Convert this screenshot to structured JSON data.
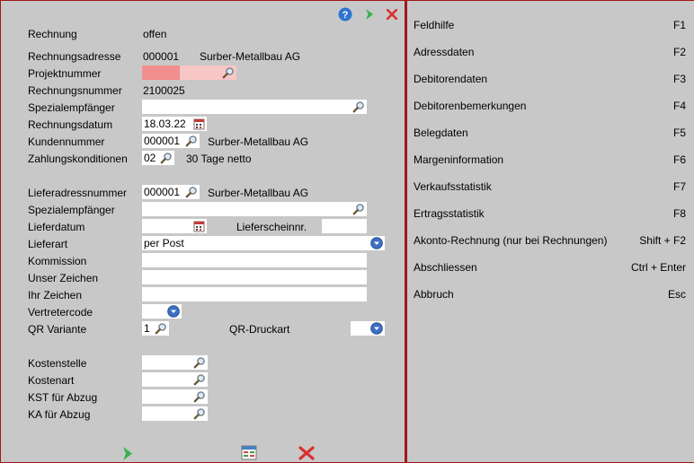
{
  "form": {
    "rechnung_label": "Rechnung",
    "rechnung_status": "offen",
    "rechnungsadresse_label": "Rechnungsadresse",
    "rechnungsadresse_nr": "000001",
    "rechnungsadresse_name": "Surber-Metallbau AG",
    "projektnummer_label": "Projektnummer",
    "projektnummer_value": "",
    "rechnungsnummer_label": "Rechnungsnummer",
    "rechnungsnummer_value": "2100025",
    "spezialempfaenger_label": "Spezialempfänger",
    "spezialempfaenger_value": "",
    "rechnungsdatum_label": "Rechnungsdatum",
    "rechnungsdatum_value": "18.03.22",
    "kundennummer_label": "Kundennummer",
    "kundennummer_value": "000001",
    "kundennummer_name": "Surber-Metallbau AG",
    "zahlungskonditionen_label": "Zahlungskonditionen",
    "zahlungskonditionen_value": "02",
    "zahlungskonditionen_text": "30 Tage netto",
    "lieferadressnummer_label": "Lieferadressnummer",
    "lieferadressnummer_value": "000001",
    "lieferadressnummer_name": "Surber-Metallbau AG",
    "spezialempfaenger2_label": "Spezialempfänger",
    "spezialempfaenger2_value": "",
    "lieferdatum_label": "Lieferdatum",
    "lieferdatum_value": "",
    "lieferscheinnr_label": "Lieferscheinnr.",
    "lieferscheinnr_value": "",
    "lieferart_label": "Lieferart",
    "lieferart_value": "per Post",
    "kommission_label": "Kommission",
    "kommission_value": "",
    "unser_zeichen_label": "Unser Zeichen",
    "unser_zeichen_value": "",
    "ihr_zeichen_label": "Ihr Zeichen",
    "ihr_zeichen_value": "",
    "vertretercode_label": "Vertretercode",
    "vertretercode_value": "",
    "qr_variante_label": "QR Variante",
    "qr_variante_value": "1",
    "qr_druckart_label": "QR-Druckart",
    "qr_druckart_value": "",
    "kostenstelle_label": "Kostenstelle",
    "kostenstelle_value": "",
    "kostenart_label": "Kostenart",
    "kostenart_value": "",
    "kst_abzug_label": "KST für Abzug",
    "kst_abzug_value": "",
    "ka_abzug_label": "KA für Abzug",
    "ka_abzug_value": ""
  },
  "icons": {
    "top_help": "help-icon",
    "top_next": "next-arrow-icon",
    "top_close": "close-icon",
    "bottom_ok": "confirm-arrow-icon",
    "bottom_document": "document-icon",
    "bottom_cancel": "cancel-icon"
  },
  "menu": [
    {
      "label": "Feldhilfe",
      "key": "F1"
    },
    {
      "label": "Adressdaten",
      "key": "F2"
    },
    {
      "label": "Debitorendaten",
      "key": "F3"
    },
    {
      "label": "Debitorenbemerkungen",
      "key": "F4"
    },
    {
      "label": "Belegdaten",
      "key": "F5"
    },
    {
      "label": "Margeninformation",
      "key": "F6"
    },
    {
      "label": "Verkaufsstatistik",
      "key": "F7"
    },
    {
      "label": "Ertragsstatistik",
      "key": "F8"
    },
    {
      "label": "Akonto-Rechnung (nur bei Rechnungen)",
      "key": "Shift + F2"
    },
    {
      "label": "Abschliessen",
      "key": "Ctrl + Enter"
    },
    {
      "label": "Abbruch",
      "key": "Esc"
    }
  ],
  "colors": {
    "border": "#a01818",
    "background": "#c8c8c8",
    "error_field": "#f7c6c6",
    "error_fill": "#f28e8e"
  }
}
